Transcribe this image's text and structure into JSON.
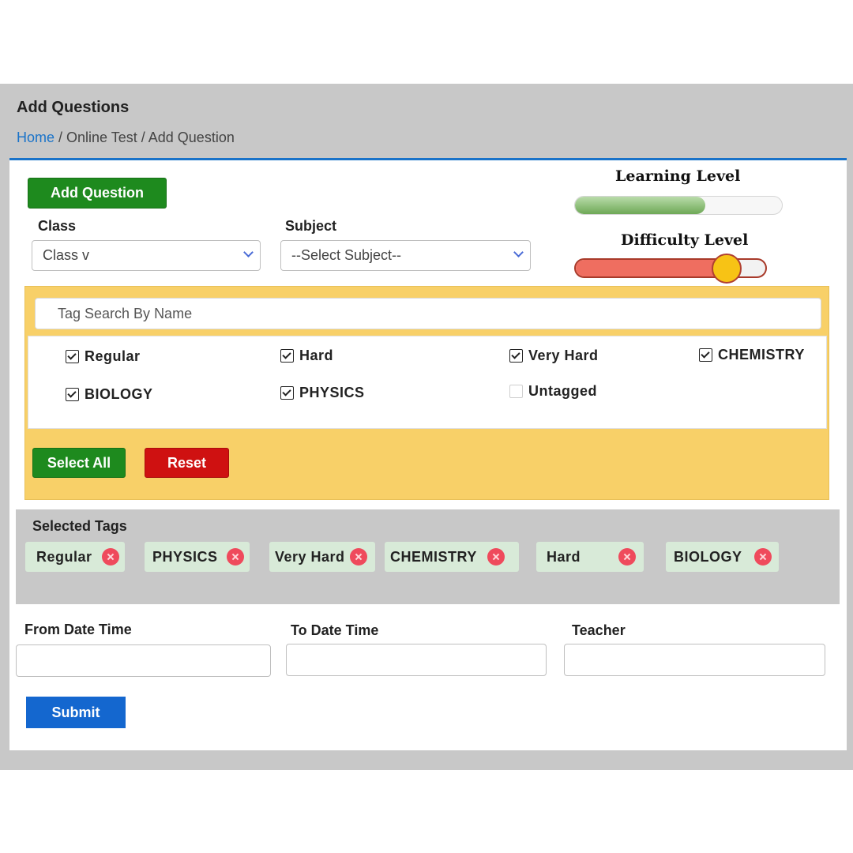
{
  "header": {
    "title": "Add Questions",
    "breadcrumb": {
      "home": "Home",
      "separator1": " / ",
      "section": "Online Test",
      "separator2": " / ",
      "current": "Add Question"
    }
  },
  "form": {
    "add_question_label": "Add Question",
    "class_label": "Class",
    "class_value": "Class v",
    "subject_label": "Subject",
    "subject_value": "--Select Subject--"
  },
  "levels": {
    "learning_label": "Learning Level",
    "learning_fraction": 0.63,
    "difficulty_label": "Difficulty Level",
    "difficulty_fraction": 0.79
  },
  "tag_filter": {
    "search_placeholder": "Tag Search By Name",
    "tags": [
      {
        "label": "Regular",
        "checked": true
      },
      {
        "label": "Hard",
        "checked": true
      },
      {
        "label": "Very Hard",
        "checked": true
      },
      {
        "label": "CHEMISTRY",
        "checked": true
      },
      {
        "label": "BIOLOGY",
        "checked": true
      },
      {
        "label": "PHYSICS",
        "checked": true
      },
      {
        "label": "Untagged",
        "checked": false
      }
    ],
    "select_all_label": "Select All",
    "reset_label": "Reset"
  },
  "selected_tags": {
    "title": "Selected Tags",
    "chips": [
      "Regular",
      "PHYSICS",
      "Very Hard",
      "CHEMISTRY",
      "Hard",
      "BIOLOGY"
    ]
  },
  "dates": {
    "from_label": "From Date Time",
    "from_value": "",
    "to_label": "To Date Time",
    "to_value": "",
    "teacher_label": "Teacher",
    "teacher_value": ""
  },
  "submit_label": "Submit",
  "colors": {
    "primary_blue": "#1467cf",
    "green": "#1e8a1e",
    "red": "#cf1111",
    "tag_panel": "#f8d068",
    "chip_bg": "#d8ead8",
    "chip_remove": "#ef4a5c"
  },
  "icons": {
    "select_chevron": "chevron-down-icon",
    "chip_remove": "close-circle-icon",
    "checkbox": "checkbox-icon"
  }
}
